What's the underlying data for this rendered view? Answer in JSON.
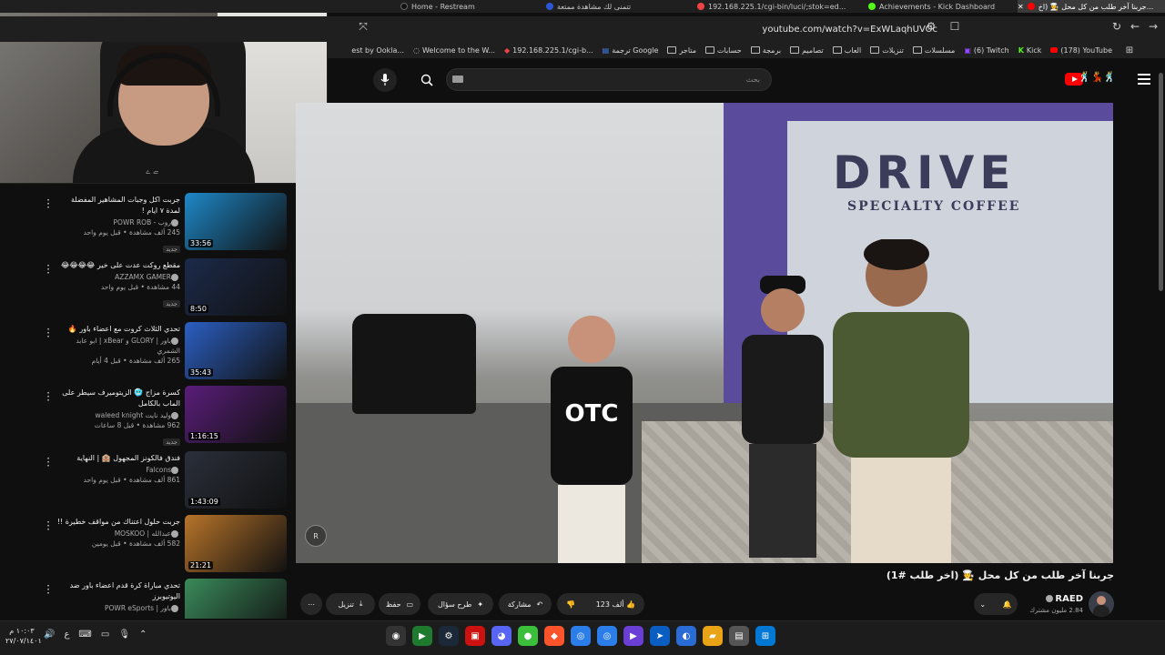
{
  "tabs": [
    {
      "label": "Home - Restream",
      "color": "#111"
    },
    {
      "label": "تتمنى لك مشاهدة ممتعة",
      "color": "#e44"
    },
    {
      "label": "192.168.225.1/cgi-bin/luci/;stok=ed...",
      "color": "#e44"
    },
    {
      "label": "Achievements - Kick Dashboard",
      "color": "#53fc18"
    },
    {
      "label": "جربنا آخر طلب من كل محل 🧑‍🍳 (اخ...",
      "color": "#f00"
    }
  ],
  "url": "youtube.com/watch?v=ExWLaqhUVOc",
  "bookmarks": [
    "(178) YouTube",
    "Kick",
    "(6) Twitch",
    "مسلسلات",
    "تنزيلات",
    "العاب",
    "تصاميم",
    "برمجة",
    "حسابات",
    "متاجر",
    "ترجمة Google",
    "192.168.225.1/cgi-b...",
    "Welcome to the W...",
    "est by Ookla..."
  ],
  "search": {
    "placeholder": "بحث"
  },
  "webcam": {
    "subtitle": "ﮯ ﮮ"
  },
  "sidebar_items": [
    {
      "title": "جربت اكل وجبات المشاهير المفضلة لمدة ٧ ايام !",
      "channel": "روب - POWR ROB",
      "views": "245 ألف مشاهدة • قبل يوم واحد",
      "badge": "جديد",
      "duration": "33:56",
      "thumb": "#1e88c8"
    },
    {
      "title": "مقطع روكت عدت على خير 😂😂😂😂",
      "channel": "AZZAMX GAMER",
      "views": "44 مشاهدة • قبل يوم واحد",
      "badge": "جديد",
      "duration": "8:50",
      "thumb": "#1b2a4a"
    },
    {
      "title": "تحدي الثلاث كروت مع اعضاء باور 🔥",
      "channel": "باور | GLORY و xBear | ابو عابد الشمري",
      "views": "265 ألف مشاهدة • قبل 4 أيام",
      "badge": "",
      "duration": "35:43",
      "thumb": "#2b5fc2"
    },
    {
      "title": "كسرة مزاج 🥶 الزيتوميرف سيطر على الماب بالكامل",
      "channel": "وليد نايت waleed knight",
      "views": "962 مشاهدة • قبل 8 ساعات",
      "badge": "جديد",
      "duration": "1:16:15",
      "thumb": "#5a1d7a"
    },
    {
      "title": "فندق فالكونز المجهول 🏨 | النهاية",
      "channel": "Falcons",
      "views": "861 ألف مشاهدة • قبل يوم واحد",
      "badge": "",
      "duration": "1:43:09",
      "thumb": "#2a2f3a"
    },
    {
      "title": "جربت حلول اعتناك من مواقف خطيرة !!",
      "channel": "عبدالله | MOSKOO",
      "views": "582 ألف مشاهدة • قبل يومين",
      "badge": "",
      "duration": "21:21",
      "thumb": "#b8742a"
    },
    {
      "title": "تحدي مباراة كرة قدم اعضاء باور ضد اليوتيوبرز",
      "channel": "باور | POWR eSports",
      "views": "",
      "badge": "",
      "duration": "",
      "thumb": "#3a8a5a"
    }
  ],
  "video": {
    "title": "جربنا آخر طلب من كل محل 🧑‍🍳 (اخر طلب #1)",
    "sign_main": "DRIVE",
    "sign_sub": "SPECIALTY COFFEE",
    "watermark": "R"
  },
  "channel": {
    "name": "RAED",
    "subs": "2.84 مليون مشترك"
  },
  "actions": {
    "likes": "123 ألف",
    "share": "مشاركة",
    "ask": "طرح سؤال",
    "save": "حفظ",
    "download": "تنزيل"
  },
  "taskbar": {
    "time": "١٠:٠٣ م",
    "date": "٢٧/٠٧/١٤٠١",
    "lang": "ع"
  }
}
